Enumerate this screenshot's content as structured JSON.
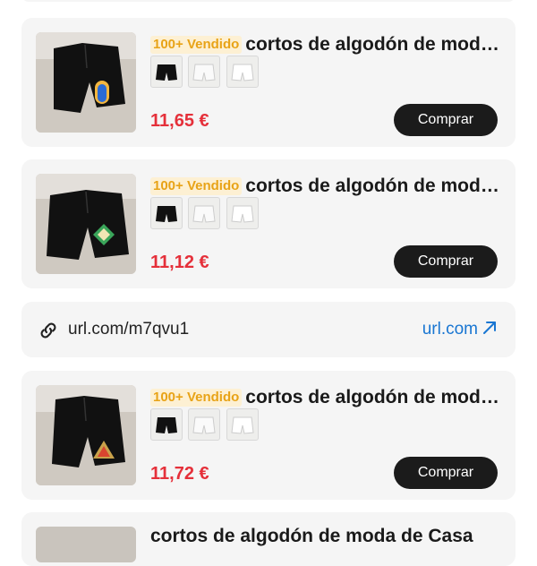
{
  "products": [
    {
      "badge": "100+ Vendido",
      "title": "cortos de algodón de moda de Casa",
      "price": "11,65 €",
      "buy_label": "Comprar",
      "emblem": "rainbow-arch"
    },
    {
      "badge": "100+ Vendido",
      "title": "cortos de algodón de moda de Casa",
      "price": "11,12 €",
      "buy_label": "Comprar",
      "emblem": "green-diamond"
    },
    {
      "badge": "100+ Vendido",
      "title": "cortos de algodón de moda de Casa",
      "price": "11,72 €",
      "buy_label": "Comprar",
      "emblem": "triangle-crest"
    }
  ],
  "link_card": {
    "url": "url.com/m7qvu1",
    "domain": "url.com",
    "icon": "link-icon",
    "external_icon": "external-link-icon"
  },
  "bottom_product": {
    "title": "cortos de algodón de moda de Casa"
  },
  "colors": {
    "badge_text": "#e8a317",
    "badge_bg": "#fdf0d3",
    "price": "#e5303a",
    "link": "#1976d2",
    "button": "#1b1b1b"
  }
}
